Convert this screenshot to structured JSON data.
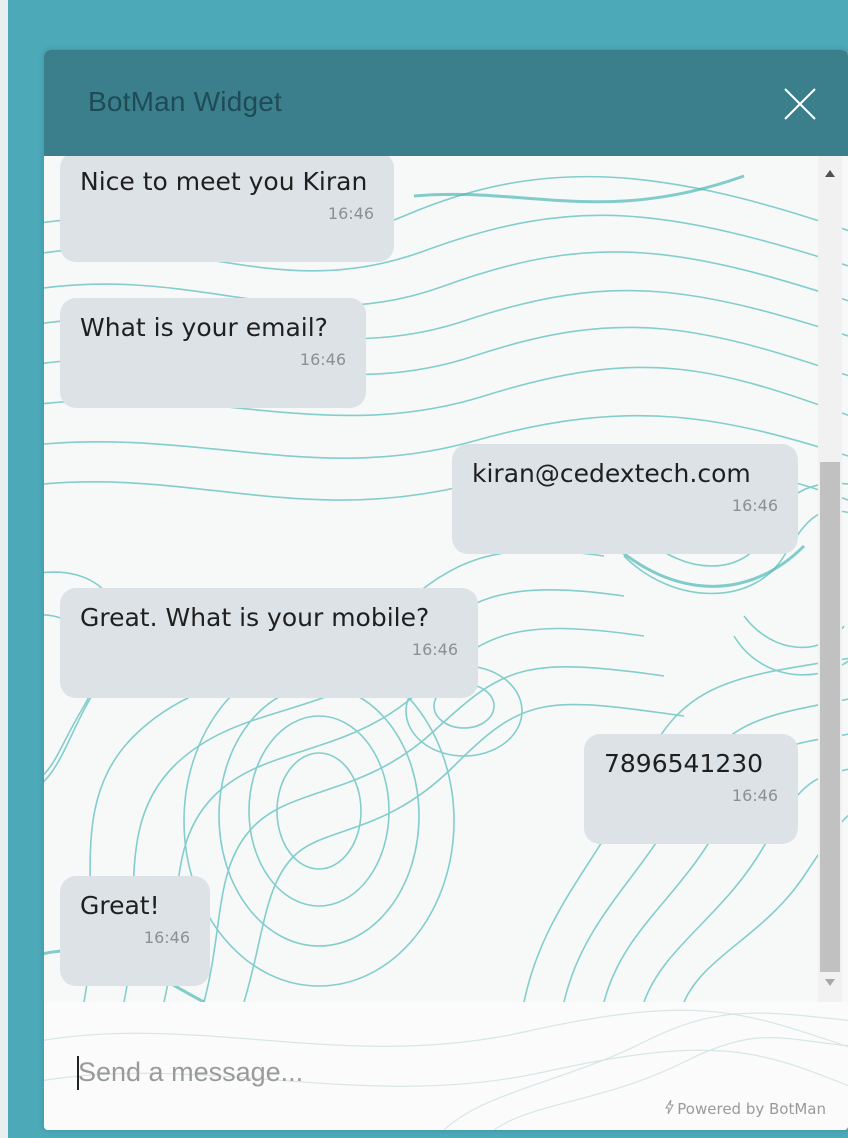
{
  "widget": {
    "title": "BotMan Widget",
    "close_icon": "close-icon"
  },
  "messages": [
    {
      "from": "bot",
      "text": "Nice to meet you Kiran",
      "time": "16:46"
    },
    {
      "from": "bot",
      "text": "What is your email?",
      "time": "16:46"
    },
    {
      "from": "user",
      "text": "kiran@cedextech.com",
      "time": "16:46"
    },
    {
      "from": "bot",
      "text": "Great. What is your mobile?",
      "time": "16:46"
    },
    {
      "from": "user",
      "text": "7896541230",
      "time": "16:46"
    },
    {
      "from": "bot",
      "text": "Great!",
      "time": "16:46"
    }
  ],
  "input": {
    "placeholder": "Send a message...",
    "value": ""
  },
  "footer": {
    "powered_by": "Powered by BotMan",
    "icon": "bolt-icon"
  },
  "colors": {
    "page_background": "#4ba9b8",
    "header": "#3b7f8d",
    "header_text": "#1f4b55",
    "bubble": "#dde2e6",
    "topo_lines": "#6fc6c4"
  }
}
